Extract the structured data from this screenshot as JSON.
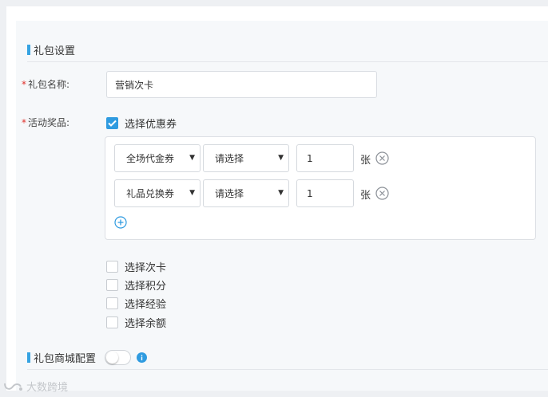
{
  "section1": {
    "title": "礼包设置"
  },
  "gift_name": {
    "label": "礼包名称:",
    "required_mark": "*",
    "value": "营销次卡"
  },
  "prizes": {
    "label": "活动奖品:",
    "required_mark": "*",
    "coupon_checkbox": {
      "label": "选择优惠券",
      "checked": true
    },
    "rows": [
      {
        "type": "全场代金券",
        "coupon": "请选择",
        "qty": "1",
        "unit": "张"
      },
      {
        "type": "礼品兑换券",
        "coupon": "请选择",
        "qty": "1",
        "unit": "张"
      }
    ],
    "add_icon": "plus-circle-icon",
    "remove_icon": "close-circle-icon",
    "other_options": [
      {
        "label": "选择次卡",
        "checked": false
      },
      {
        "label": "选择积分",
        "checked": false
      },
      {
        "label": "选择经验",
        "checked": false
      },
      {
        "label": "选择余额",
        "checked": false
      }
    ]
  },
  "section2": {
    "title": "礼包商城配置",
    "toggle_on": false,
    "info_icon": "info-icon"
  },
  "watermark": {
    "text": "大数跨境",
    "icon": "watermark-logo"
  },
  "colors": {
    "accent": "#2f9be0",
    "required": "#e0302a",
    "section_bar": "#36a3e2"
  }
}
